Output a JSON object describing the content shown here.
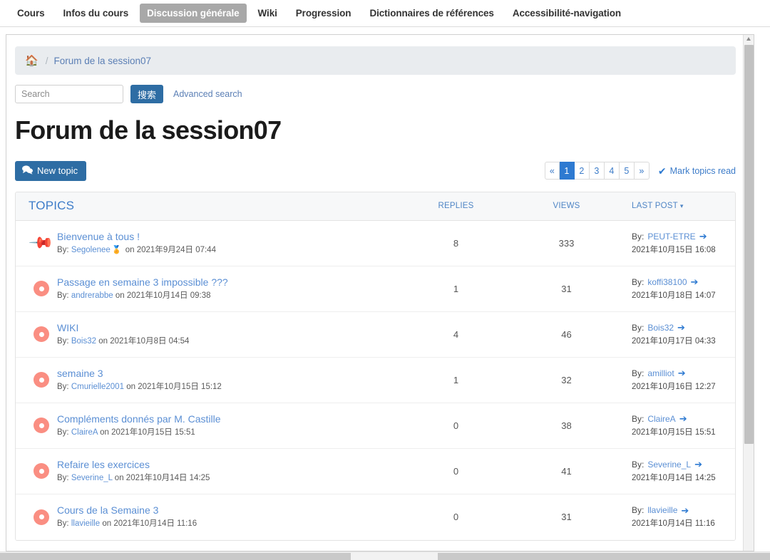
{
  "tabs": [
    {
      "label": "Cours",
      "active": false
    },
    {
      "label": "Infos du cours",
      "active": false
    },
    {
      "label": "Discussion générale",
      "active": true
    },
    {
      "label": "Wiki",
      "active": false
    },
    {
      "label": "Progression",
      "active": false
    },
    {
      "label": "Dictionnaires de références",
      "active": false
    },
    {
      "label": "Accessibilité-navigation",
      "active": false
    }
  ],
  "breadcrumb": {
    "home_icon": "home-icon",
    "separator": "/",
    "current": "Forum de la session07"
  },
  "search": {
    "placeholder": "Search",
    "value": "",
    "button_label": "搜索",
    "advanced_label": "Advanced search"
  },
  "page_title": "Forum de la session07",
  "actions": {
    "new_topic_label": "New topic",
    "new_topic_icon": "comments-icon",
    "mark_read_label": "Mark topics read",
    "mark_read_icon": "check-circle-icon"
  },
  "pagination": {
    "prev": "«",
    "next": "»",
    "pages": [
      "1",
      "2",
      "3",
      "4",
      "5"
    ],
    "active_page": "1"
  },
  "table": {
    "headers": {
      "topics": "TOPICS",
      "replies": "REPLIES",
      "views": "VIEWS",
      "last_post": "LAST POST",
      "sort_caret": "▾"
    },
    "rows": [
      {
        "icon": "pin-icon",
        "title": "Bienvenue à tous !",
        "by_prefix": "By:",
        "author": "Segolenee",
        "author_badge": "award-icon",
        "on_text": "on",
        "created": "2021年9月24日 07:44",
        "replies": "8",
        "views": "333",
        "last_by_prefix": "By:",
        "last_author": "PEUT-ETRE",
        "last_arrow_icon": "arrow-circle-right-icon",
        "last_date": "2021年10月15日 16:08"
      },
      {
        "icon": "topic-dot-icon",
        "title": "Passage en semaine 3 impossible ???",
        "by_prefix": "By:",
        "author": "andrerabbe",
        "author_badge": "",
        "on_text": "on",
        "created": "2021年10月14日 09:38",
        "replies": "1",
        "views": "31",
        "last_by_prefix": "By:",
        "last_author": "koffi38100",
        "last_arrow_icon": "arrow-circle-right-icon",
        "last_date": "2021年10月18日 14:07"
      },
      {
        "icon": "topic-dot-icon",
        "title": "WIKI",
        "by_prefix": "By:",
        "author": "Bois32",
        "author_badge": "",
        "on_text": "on",
        "created": "2021年10月8日 04:54",
        "replies": "4",
        "views": "46",
        "last_by_prefix": "By:",
        "last_author": "Bois32",
        "last_arrow_icon": "arrow-circle-right-icon",
        "last_date": "2021年10月17日 04:33"
      },
      {
        "icon": "topic-dot-icon",
        "title": "semaine 3",
        "by_prefix": "By:",
        "author": "Cmurielle2001",
        "author_badge": "",
        "on_text": "on",
        "created": "2021年10月15日 15:12",
        "replies": "1",
        "views": "32",
        "last_by_prefix": "By:",
        "last_author": "amilliot",
        "last_arrow_icon": "arrow-circle-right-icon",
        "last_date": "2021年10月16日 12:27"
      },
      {
        "icon": "topic-dot-icon",
        "title": "Compléments donnés par M. Castille",
        "by_prefix": "By:",
        "author": "ClaireA",
        "author_badge": "",
        "on_text": "on",
        "created": "2021年10月15日 15:51",
        "replies": "0",
        "views": "38",
        "last_by_prefix": "By:",
        "last_author": "ClaireA",
        "last_arrow_icon": "arrow-circle-right-icon",
        "last_date": "2021年10月15日 15:51"
      },
      {
        "icon": "topic-dot-icon",
        "title": "Refaire les exercices",
        "by_prefix": "By:",
        "author": "Severine_L",
        "author_badge": "",
        "on_text": "on",
        "created": "2021年10月14日 14:25",
        "replies": "0",
        "views": "41",
        "last_by_prefix": "By:",
        "last_author": "Severine_L",
        "last_arrow_icon": "arrow-circle-right-icon",
        "last_date": "2021年10月14日 14:25"
      },
      {
        "icon": "topic-dot-icon",
        "title": "Cours de la Semaine 3",
        "by_prefix": "By:",
        "author": "llavieille",
        "author_badge": "",
        "on_text": "on",
        "created": "2021年10月14日 11:16",
        "replies": "0",
        "views": "31",
        "last_by_prefix": "By:",
        "last_author": "llavieille",
        "last_arrow_icon": "arrow-circle-right-icon",
        "last_date": "2021年10月14日 11:16"
      }
    ]
  },
  "colors": {
    "primary": "#2e6da4",
    "link": "#5b8fd4",
    "accent_active": "#2e7ad1",
    "topic_icon": "#fa8e82",
    "tab_active_bg": "#a8a8a8"
  }
}
